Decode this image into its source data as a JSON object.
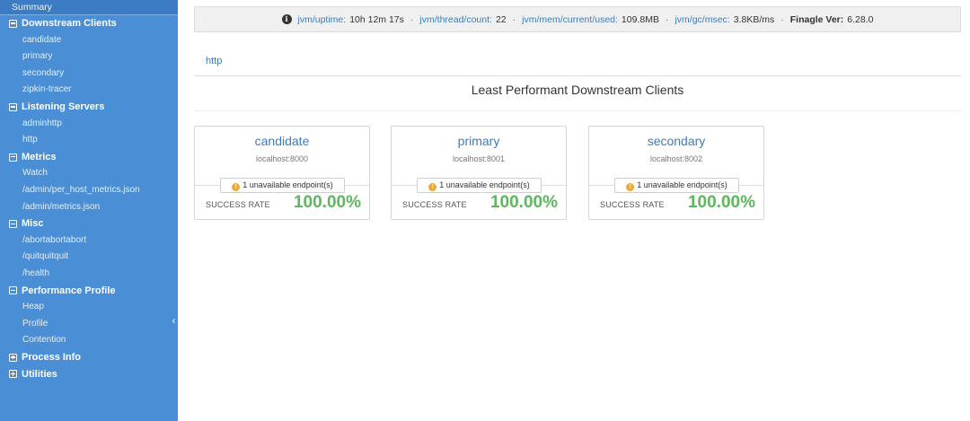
{
  "sidebar": {
    "summary": "Summary",
    "groups": [
      {
        "title": "Downstream Clients",
        "toggle": "minus",
        "items": [
          "candidate",
          "primary",
          "secondary",
          "zipkin-tracer"
        ]
      },
      {
        "title": "Listening Servers",
        "toggle": "minus",
        "items": [
          "adminhttp",
          "http"
        ]
      },
      {
        "title": "Metrics",
        "toggle": "minus",
        "items": [
          "Watch",
          "/admin/per_host_metrics.json",
          "/admin/metrics.json"
        ]
      },
      {
        "title": "Misc",
        "toggle": "minus",
        "items": [
          "/abortabortabort",
          "/quitquitquit",
          "/health"
        ]
      },
      {
        "title": "Performance Profile",
        "toggle": "minus",
        "items": [
          "Heap",
          "Profile",
          "Contention"
        ]
      },
      {
        "title": "Process Info",
        "toggle": "plus",
        "items": []
      },
      {
        "title": "Utilities",
        "toggle": "plus",
        "items": []
      }
    ],
    "collapse_glyph": "‹"
  },
  "stats": {
    "info_glyph": "i",
    "uptime_label": "jvm/uptime:",
    "uptime": "10h 12m 17s",
    "threads_label": "jvm/thread/count:",
    "threads": "22",
    "mem_label": "jvm/mem/current/used:",
    "mem": "109.8MB",
    "gc_label": "jvm/gc/msec:",
    "gc": "3.8KB/ms",
    "finagle_label": "Finagle Ver:",
    "finagle": "6.28.0",
    "sep": "·"
  },
  "tab": "http",
  "section_title": "Least Performant Downstream Clients",
  "clients": [
    {
      "name": "candidate",
      "address": "localhost:8000",
      "badge": "1 unavailable endpoint(s)",
      "sr_label": "SUCCESS RATE",
      "sr_value": "100.00%"
    },
    {
      "name": "primary",
      "address": "localhost:8001",
      "badge": "1 unavailable endpoint(s)",
      "sr_label": "SUCCESS RATE",
      "sr_value": "100.00%"
    },
    {
      "name": "secondary",
      "address": "localhost:8002",
      "badge": "1 unavailable endpoint(s)",
      "sr_label": "SUCCESS RATE",
      "sr_value": "100.00%"
    }
  ],
  "colors": {
    "sidebar": "#4a8fd6",
    "link": "#3a7cc0",
    "success": "#5cb85c",
    "warn": "#f0a830"
  }
}
